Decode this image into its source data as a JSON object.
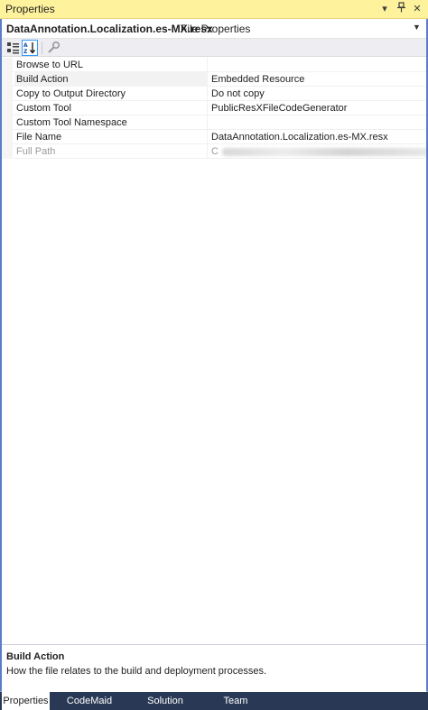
{
  "window": {
    "title": "Properties"
  },
  "object_selector": {
    "name": "DataAnnotation.Localization.es-MX.resx",
    "type": "File Properties"
  },
  "toolbar": {
    "buttons": [
      {
        "icon": "categorized-icon",
        "pressed": false
      },
      {
        "icon": "alphabetical-icon",
        "pressed": true
      },
      {
        "icon": "property-pages-icon",
        "pressed": false
      }
    ]
  },
  "properties": [
    {
      "name": "Browse to URL",
      "value": ""
    },
    {
      "name": "Build Action",
      "value": "Embedded Resource"
    },
    {
      "name": "Copy to Output Directory",
      "value": "Do not copy"
    },
    {
      "name": "Custom Tool",
      "value": "PublicResXFileCodeGenerator"
    },
    {
      "name": "Custom Tool Namespace",
      "value": ""
    },
    {
      "name": "File Name",
      "value": "DataAnnotation.Localization.es-MX.resx"
    },
    {
      "name": "Full Path",
      "value": "C",
      "redacted": true
    }
  ],
  "description": {
    "title": "Build Action",
    "text": "How the file relates to the build and deployment processes."
  },
  "tabs": [
    {
      "label": "Properties",
      "active": true
    },
    {
      "label": "CodeMaid Spade",
      "active": false
    },
    {
      "label": "Solution Explorer",
      "active": false
    },
    {
      "label": "Team Explorer",
      "active": false
    }
  ],
  "colors": {
    "titlebar": "#fff29d",
    "frame_border": "#5c7cc7",
    "tabbar": "#293955"
  }
}
